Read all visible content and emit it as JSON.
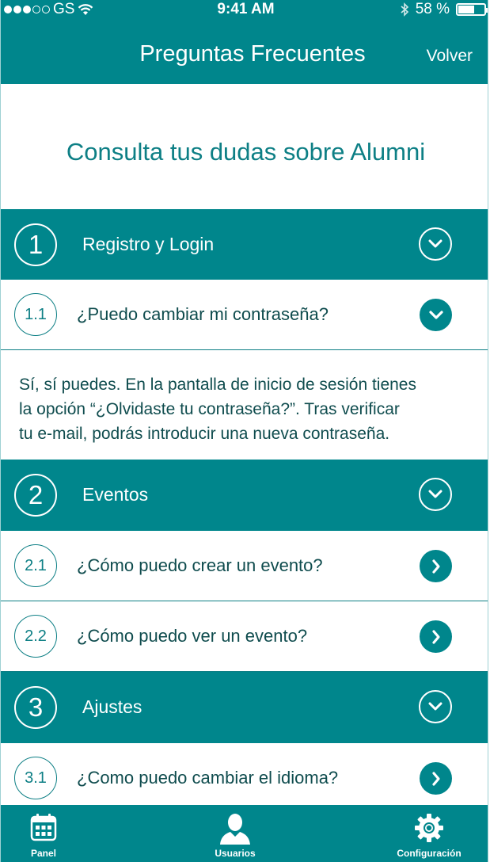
{
  "status_bar": {
    "carrier": "GS",
    "time": "9:41 AM",
    "battery": "58 %",
    "battery_level": 0.58
  },
  "nav": {
    "title": "Preguntas Frecuentes",
    "back_label": "Volver"
  },
  "subtitle": "Consulta tus dudas sobre Alumni",
  "sections": [
    {
      "number": "1",
      "label": "Registro y Login",
      "items": [
        {
          "number": "1.1",
          "label": "¿Puedo cambiar mi contraseña?",
          "expanded": true
        }
      ]
    },
    {
      "number": "2",
      "label": "Eventos",
      "items": [
        {
          "number": "2.1",
          "label": "¿Cómo puedo crear un evento?",
          "expanded": false
        },
        {
          "number": "2.2",
          "label": "¿Cómo puedo ver un evento?",
          "expanded": false
        }
      ]
    },
    {
      "number": "3",
      "label": "Ajustes",
      "items": [
        {
          "number": "3.1",
          "label": "¿Como puedo cambiar el idioma?",
          "expanded": false
        }
      ]
    }
  ],
  "answer": {
    "line1": "Sí, sí puedes. En la pantalla de inicio de sesión tienes",
    "line2": "la opción “¿Olvidaste tu contraseña?”. Tras verificar",
    "line3": "tu e-mail, podrás introducir una nueva contraseña."
  },
  "tabs": [
    {
      "label": "Panel",
      "icon": "calendar-icon"
    },
    {
      "label": "Usuarios",
      "icon": "user-icon"
    },
    {
      "label": "Configuración",
      "icon": "gear-icon"
    }
  ],
  "colors": {
    "primary": "#00868c",
    "text_dark": "#0f4c4e",
    "text_accent": "#0d7f85"
  }
}
